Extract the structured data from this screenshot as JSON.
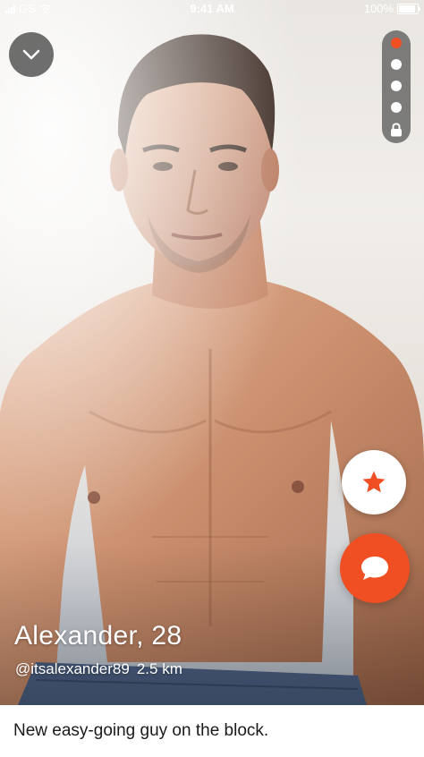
{
  "status_bar": {
    "carrier": "GS",
    "time": "9:41 AM",
    "battery": "100%"
  },
  "profile": {
    "name_age": "Alexander, 28",
    "handle": "@itsalexander89",
    "distance": "2.5 km",
    "bio": "New easy-going guy on the block."
  },
  "pager": {
    "total": 5,
    "active_index": 0,
    "last_is_locked": true
  },
  "icons": {
    "collapse": "chevron-down-icon",
    "favorite": "star-icon",
    "chat": "chat-bubble-icon",
    "lock": "lock-icon"
  },
  "colors": {
    "accent": "#f04e23",
    "overlay": "#4a4a4a"
  }
}
